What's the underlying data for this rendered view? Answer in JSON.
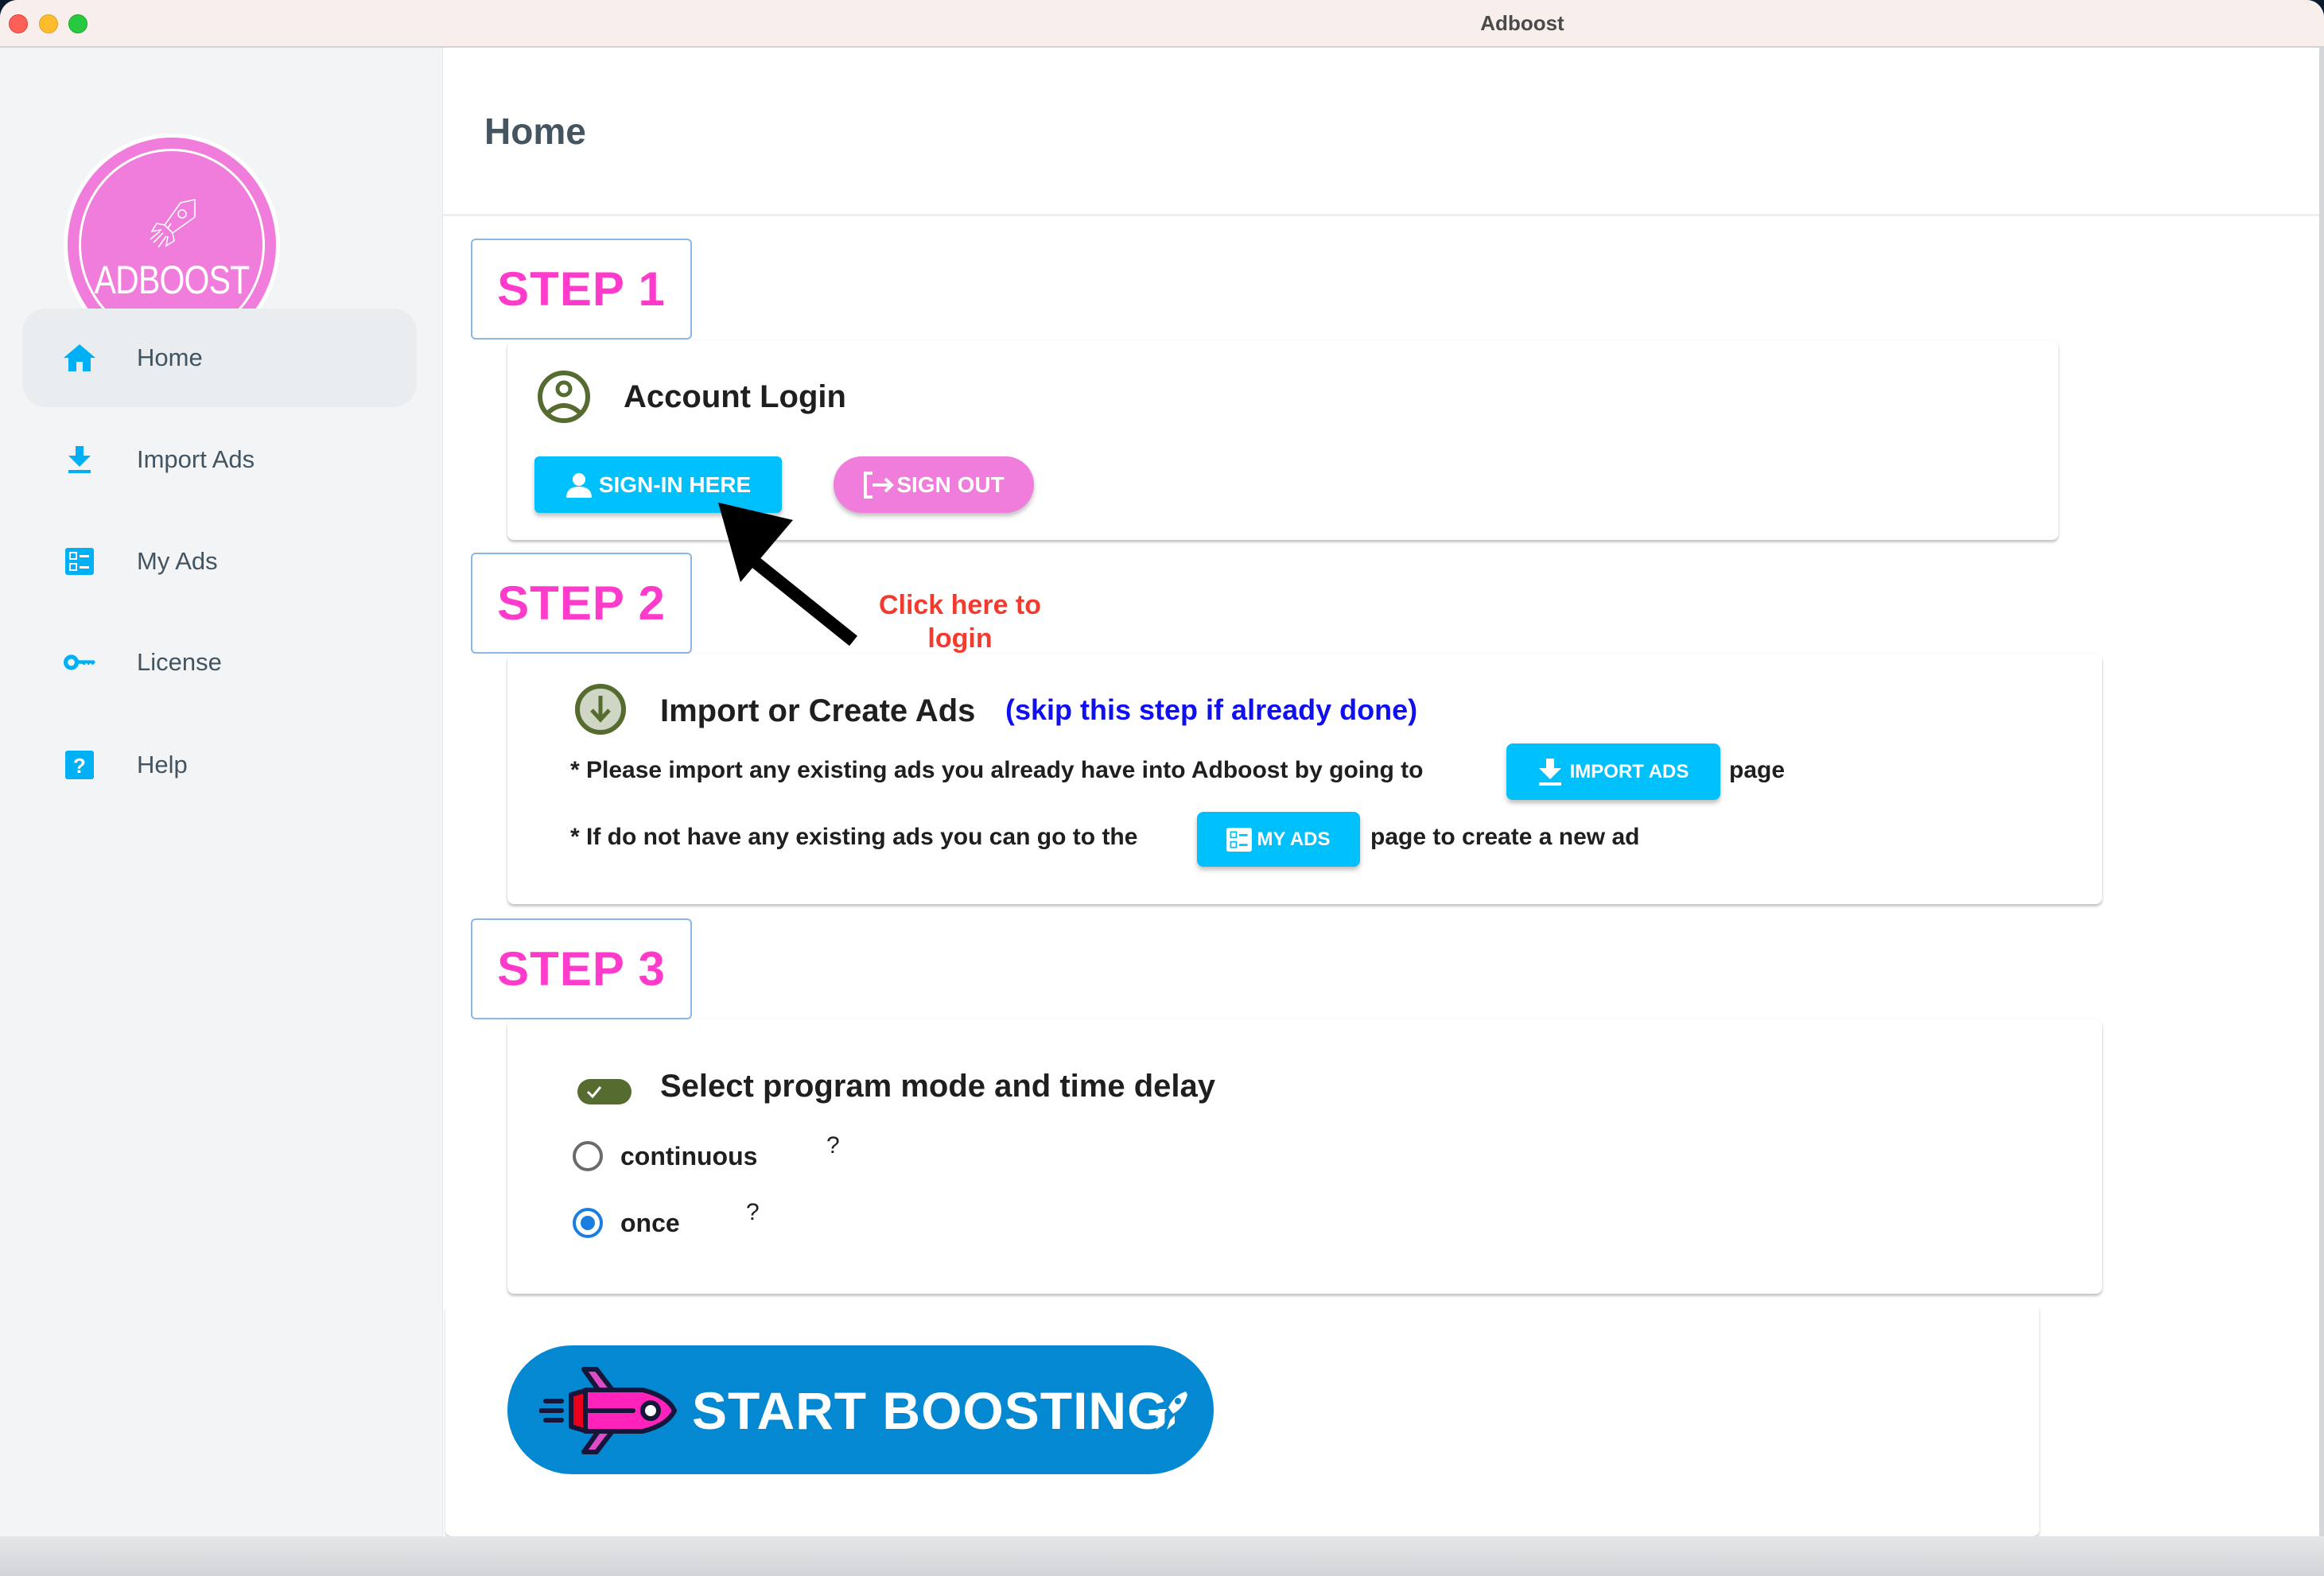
{
  "window": {
    "title": "Adboost"
  },
  "sidebar": {
    "logo_text": "ADBOOST",
    "items": [
      {
        "label": "Home",
        "icon": "home-icon",
        "active": true
      },
      {
        "label": "Import Ads",
        "icon": "download-icon",
        "active": false
      },
      {
        "label": "My Ads",
        "icon": "list-icon",
        "active": false
      },
      {
        "label": "License",
        "icon": "key-icon",
        "active": false
      },
      {
        "label": "Help",
        "icon": "help-icon",
        "active": false
      }
    ]
  },
  "header": {
    "title": "Home"
  },
  "steps": {
    "step1": {
      "label": "STEP 1",
      "title": "Account Login",
      "signin_label": "SIGN-IN HERE",
      "signout_label": "SIGN OUT",
      "annotation": "Click here to login"
    },
    "step2": {
      "label": "STEP 2",
      "title": "Import or Create Ads",
      "hint": "(skip this step if already done)",
      "line1_before": "* Please import any existing ads you already have into Adboost by going to",
      "line1_button": "IMPORT ADS",
      "line1_after": "page",
      "line2_before": "* If do not have any existing ads you can go to the",
      "line2_button": "MY ADS",
      "line2_after": "page to create a new ad"
    },
    "step3": {
      "label": "STEP 3",
      "title": "Select program mode and time delay",
      "toggle_on": true,
      "options": [
        {
          "label": "continuous",
          "selected": false,
          "help": "?"
        },
        {
          "label": "once",
          "selected": true,
          "help": "?"
        }
      ]
    }
  },
  "start": {
    "label": "START BOOSTING"
  },
  "colors": {
    "accent_blue": "#00c0fb",
    "accent_pink": "#f07ddc",
    "step_pink": "#ff3bcb",
    "start_blue": "#0388d1",
    "olive": "#556b2f",
    "annotation_red": "#f23b2e",
    "hint_blue": "#1010ee"
  }
}
